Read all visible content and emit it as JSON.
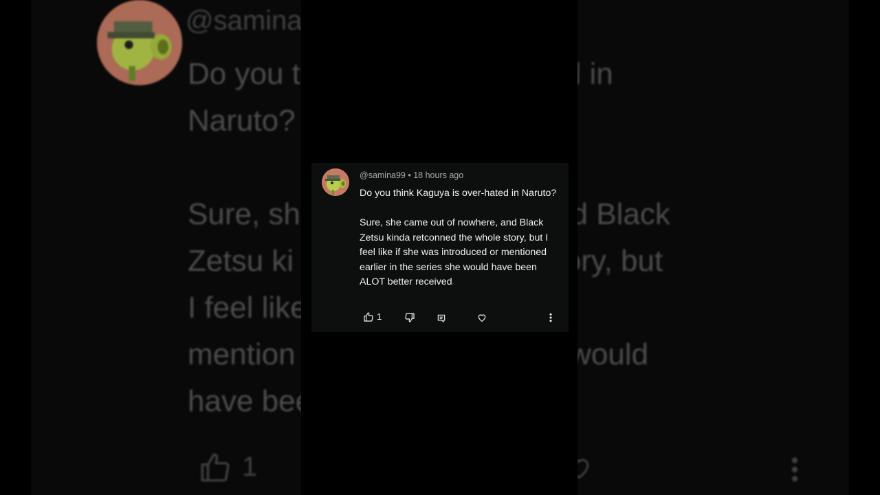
{
  "comment": {
    "handle": "@samina99",
    "separator": "•",
    "time": "18 hours ago",
    "meta_line": "@samina99 • 18 hours ago",
    "text": "Do you think Kaguya is over-hated in Naruto?\n\nSure, she came out of nowhere, and Black Zetsu kinda retconned the whole story, but I feel like if she was introduced or mentioned earlier in the series she would have been ALOT better received",
    "likes": "1"
  },
  "background": {
    "handle": "@samina",
    "text": "Do you t                      r-hated in\nNaruto?\n\nSure, sh                   here, and Black\nZetsu ki                   whole story, but\nI feel like                   ced or\nmention                   ries she would\nhave bee                   eived",
    "likes": "1"
  },
  "icons": {
    "like": "thumbs-up-icon",
    "dislike": "thumbs-down-icon",
    "reply": "reply-icon",
    "heart": "heart-icon",
    "more": "more-vertical-icon"
  },
  "colors": {
    "card_bg": "#0d0f0e",
    "text": "#f1f1f1",
    "meta": "#a8a8a8",
    "avatar_bg": "#b46a55",
    "peashooter_green": "#b7cf4a"
  }
}
